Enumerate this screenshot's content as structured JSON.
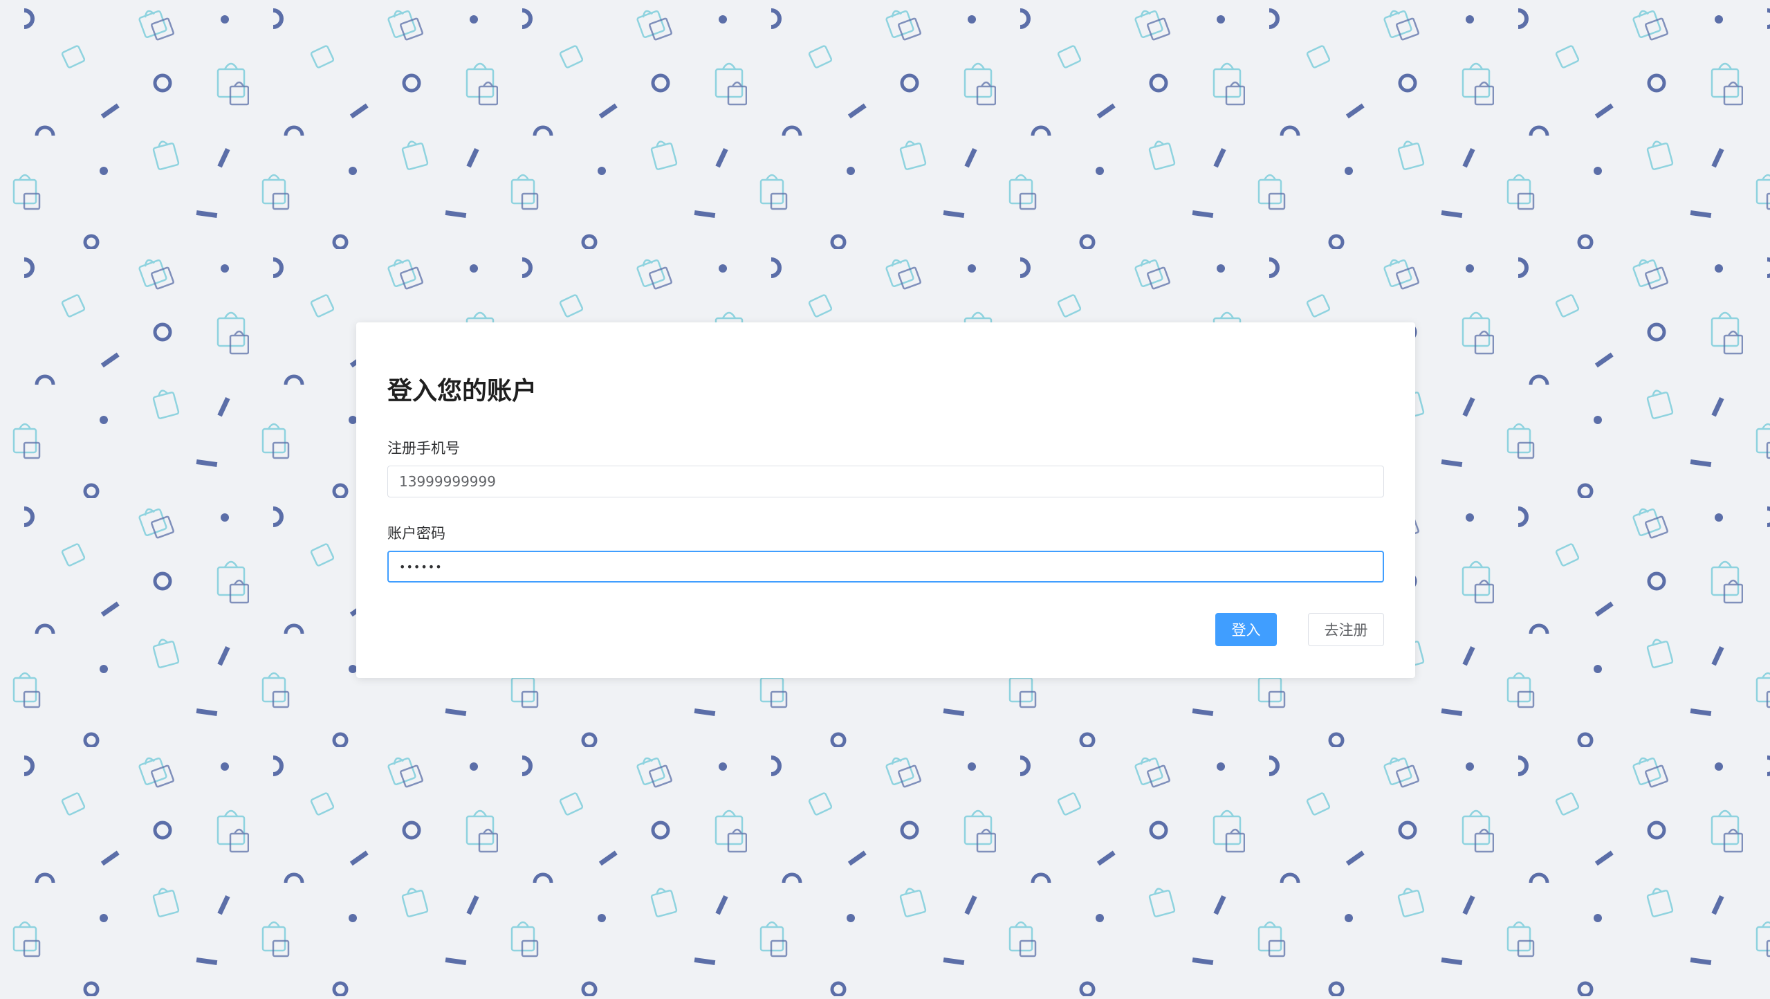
{
  "colors": {
    "page_background": "#f0f2f5",
    "pattern_dark": "#5b6ea8",
    "pattern_light": "#8fd3df",
    "card_background": "#ffffff",
    "primary": "#409eff",
    "focused_border": "#409eff"
  },
  "background_pattern": {
    "icons": [
      "shopping-bag-icon",
      "shopping-bag-pair-icon",
      "ring-shape",
      "dot-shape",
      "dash-shape",
      "arc-shape"
    ]
  },
  "login_form": {
    "title": "登入您的账户",
    "phone": {
      "label": "注册手机号",
      "value": "13999999999"
    },
    "password": {
      "label": "账户密码",
      "value": "••••••"
    },
    "login_button": "登入",
    "register_button": "去注册"
  }
}
